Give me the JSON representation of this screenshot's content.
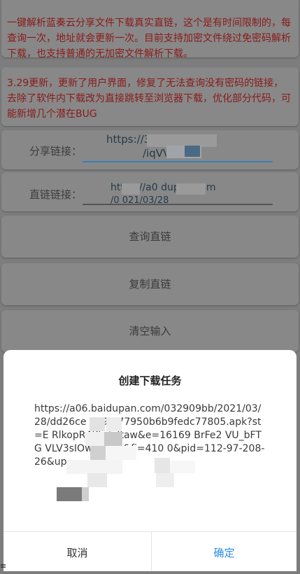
{
  "notices": [
    "一键解析蓝奏云分享文件下载真实直链，这个是有时间限制的，每查询一次，地址就会更新一次。目前支持加密文件绕过免密码解析下载，也支持普通的无加密文件解析下载。",
    "3.29更新，更新了用户界面，修复了无法查询没有密码的链接，去除了软件内下载改为直接跳转至浏览器下载，优化部分代码，可能新增几个潜在BUG"
  ],
  "share_field": {
    "label": "分享链接：",
    "value_line1": "https://3m          s.com",
    "value_line2": "/iqVV"
  },
  "direct_field": {
    "label": "直链链接：",
    "value_line1": "https://a0      dupan.com",
    "value_line2": "  /0    021/03/28"
  },
  "buttons": {
    "query": "查询直链",
    "copy": "复制直链",
    "clear": "清空输入"
  },
  "dialog": {
    "title": "创建下载任务",
    "url": "https://a06.baidupan.com/032909bb/2021/03/28/dd26ce      7598f77950b6b9fedc77805.apk?st=E      RlkopR4KbrjyItaw&e=16169       BrFe2             VU_bFTG      VLV3sIOwx8      s_c&fi=410      0&pid=112-97-208-26&up=",
    "cancel": "取消",
    "confirm": "确定"
  },
  "colors": {
    "overlay_bg": "#7d7d7d",
    "notice_text": "#8a1a1a",
    "confirm_blue": "#2a8be0",
    "underline_blue": "#3a7fb4"
  }
}
